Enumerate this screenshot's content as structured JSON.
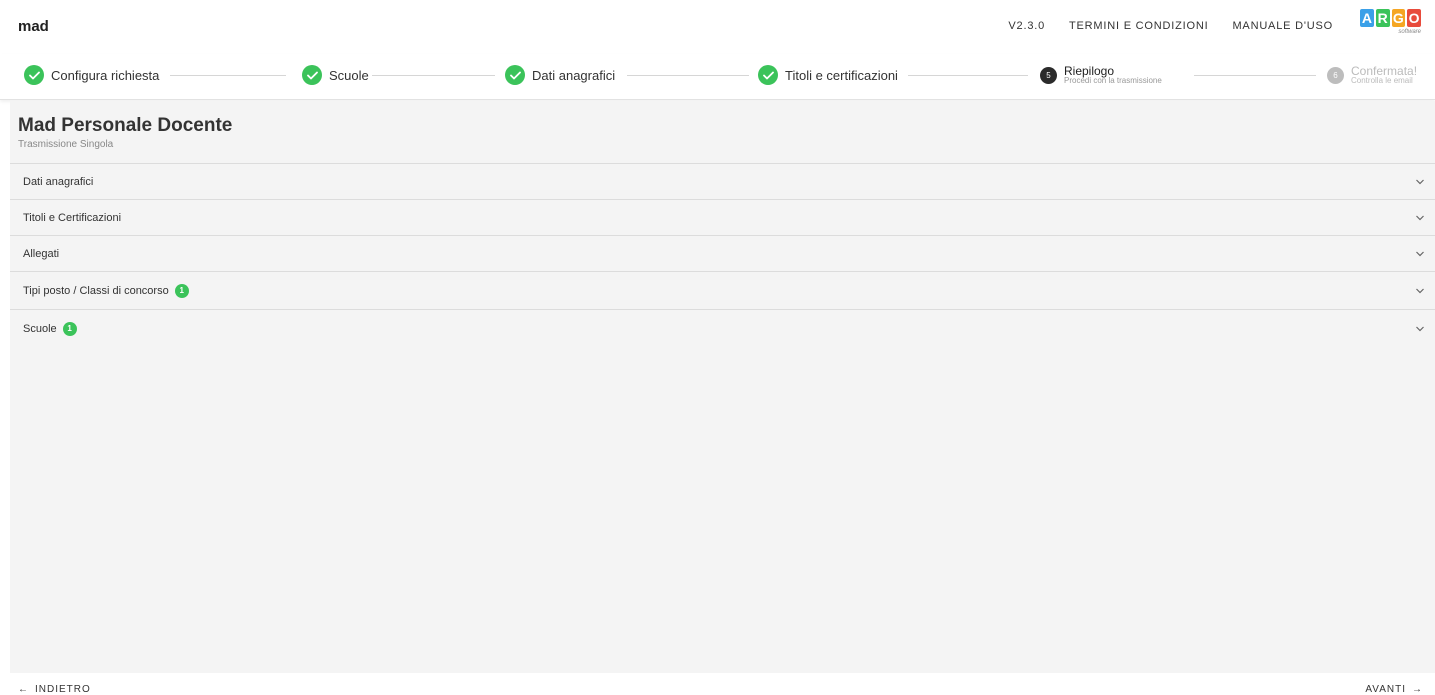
{
  "header": {
    "app_name": "mad",
    "version": "V2.3.0",
    "terms_link": "TERMINI E CONDIZIONI",
    "manual_link": "MANUALE D'USO",
    "logo": {
      "letters": [
        "A",
        "R",
        "G",
        "O"
      ],
      "letter_colors": [
        "#3aa0e8",
        "#3bc35a",
        "#f5a623",
        "#e84b3c"
      ],
      "subtext": "software"
    }
  },
  "stepper": {
    "steps": [
      {
        "label": "Configura richiesta",
        "status": "done"
      },
      {
        "label": "Scuole",
        "status": "done"
      },
      {
        "label": "Dati anagrafici",
        "status": "done"
      },
      {
        "label": "Titoli e certificazioni",
        "status": "done"
      },
      {
        "number": "5",
        "label": "Riepilogo",
        "sublabel": "Procedi con la trasmissione",
        "status": "active"
      },
      {
        "number": "6",
        "label": "Confermata!",
        "sublabel": "Controlla le email",
        "status": "pending"
      }
    ],
    "colors": {
      "done": "#3bc35a",
      "active": "#2b2b2b",
      "pending": "#bdbdbd"
    }
  },
  "main": {
    "title": "Mad Personale Docente",
    "subtitle": "Trasmissione Singola",
    "sections": [
      {
        "label": "Dati anagrafici"
      },
      {
        "label": "Titoli e Certificazioni"
      },
      {
        "label": "Allegati"
      },
      {
        "label": "Tipi posto / Classi di concorso",
        "badge": "1"
      },
      {
        "label": "Scuole",
        "badge": "1"
      }
    ]
  },
  "footer": {
    "back_label": "INDIETRO",
    "back_icon": "arrow-left-icon",
    "next_label": "AVANTI",
    "next_icon": "arrow-right-icon"
  }
}
